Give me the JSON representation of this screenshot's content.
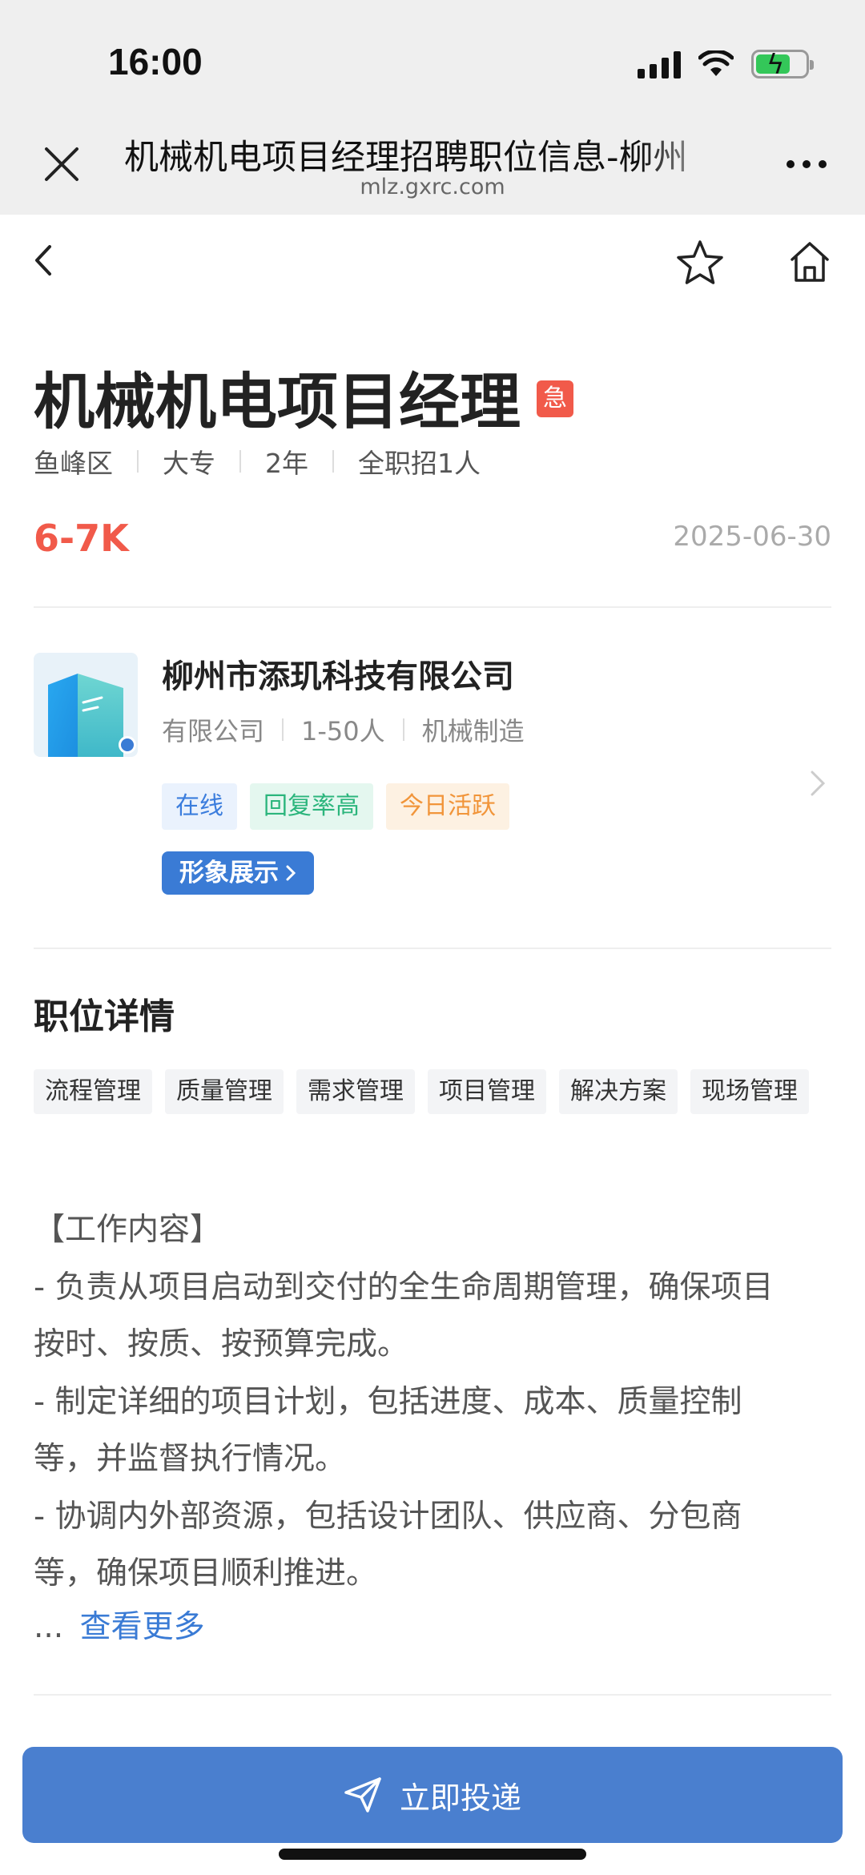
{
  "status_bar": {
    "time": "16:00"
  },
  "browser": {
    "title": "机械机电项目经理招聘职位信息-柳州",
    "url": "mlz.gxrc.com"
  },
  "job": {
    "title": "机械机电项目经理",
    "urgent_badge": "急",
    "meta": [
      "鱼峰区",
      "大专",
      "2年",
      "全职招1人"
    ],
    "salary": "6-7K",
    "date": "2025-06-30"
  },
  "company": {
    "name": "柳州市添玑科技有限公司",
    "meta": [
      "有限公司",
      "1-50人",
      "机械制造"
    ],
    "tags": [
      {
        "label": "在线",
        "color": "#3b7ddd"
      },
      {
        "label": "回复率高",
        "color": "#2bb57c"
      },
      {
        "label": "今日活跃",
        "color": "#f1953a"
      }
    ],
    "showcase_label": "形象展示"
  },
  "details": {
    "section_title": "职位详情",
    "skills": [
      "流程管理",
      "质量管理",
      "需求管理",
      "项目管理",
      "解决方案",
      "现场管理"
    ],
    "description_lines": [
      "【工作内容】",
      "- 负责从项目启动到交付的全生命周期管理，确保项目",
      "按时、按质、按预算完成。",
      "- 制定详细的项目计划，包括进度、成本、质量控制",
      "等，并监督执行情况。",
      "- 协调内外部资源，包括设计团队、供应商、分包商",
      "等，确保项目顺利推进。"
    ],
    "ellipsis": "...",
    "see_more": "查看更多"
  },
  "apply": {
    "label": "立即投递"
  },
  "colors": {
    "accent": "#3a7bd5",
    "salary": "#f15a4a",
    "apply_button": "#4a7fcf"
  }
}
